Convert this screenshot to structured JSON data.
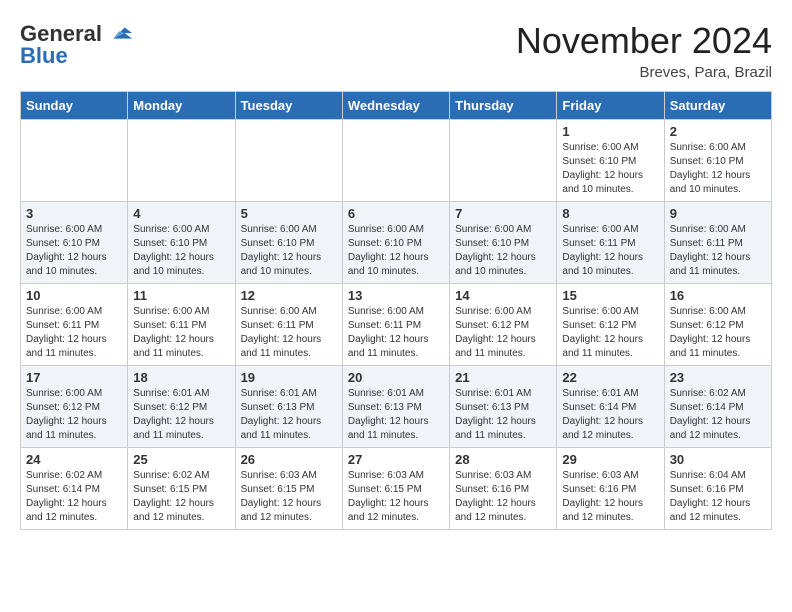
{
  "header": {
    "logo_general": "General",
    "logo_blue": "Blue",
    "month_title": "November 2024",
    "location": "Breves, Para, Brazil"
  },
  "days_of_week": [
    "Sunday",
    "Monday",
    "Tuesday",
    "Wednesday",
    "Thursday",
    "Friday",
    "Saturday"
  ],
  "weeks": [
    [
      {
        "day": "",
        "info": ""
      },
      {
        "day": "",
        "info": ""
      },
      {
        "day": "",
        "info": ""
      },
      {
        "day": "",
        "info": ""
      },
      {
        "day": "",
        "info": ""
      },
      {
        "day": "1",
        "info": "Sunrise: 6:00 AM\nSunset: 6:10 PM\nDaylight: 12 hours\nand 10 minutes."
      },
      {
        "day": "2",
        "info": "Sunrise: 6:00 AM\nSunset: 6:10 PM\nDaylight: 12 hours\nand 10 minutes."
      }
    ],
    [
      {
        "day": "3",
        "info": "Sunrise: 6:00 AM\nSunset: 6:10 PM\nDaylight: 12 hours\nand 10 minutes."
      },
      {
        "day": "4",
        "info": "Sunrise: 6:00 AM\nSunset: 6:10 PM\nDaylight: 12 hours\nand 10 minutes."
      },
      {
        "day": "5",
        "info": "Sunrise: 6:00 AM\nSunset: 6:10 PM\nDaylight: 12 hours\nand 10 minutes."
      },
      {
        "day": "6",
        "info": "Sunrise: 6:00 AM\nSunset: 6:10 PM\nDaylight: 12 hours\nand 10 minutes."
      },
      {
        "day": "7",
        "info": "Sunrise: 6:00 AM\nSunset: 6:10 PM\nDaylight: 12 hours\nand 10 minutes."
      },
      {
        "day": "8",
        "info": "Sunrise: 6:00 AM\nSunset: 6:11 PM\nDaylight: 12 hours\nand 10 minutes."
      },
      {
        "day": "9",
        "info": "Sunrise: 6:00 AM\nSunset: 6:11 PM\nDaylight: 12 hours\nand 11 minutes."
      }
    ],
    [
      {
        "day": "10",
        "info": "Sunrise: 6:00 AM\nSunset: 6:11 PM\nDaylight: 12 hours\nand 11 minutes."
      },
      {
        "day": "11",
        "info": "Sunrise: 6:00 AM\nSunset: 6:11 PM\nDaylight: 12 hours\nand 11 minutes."
      },
      {
        "day": "12",
        "info": "Sunrise: 6:00 AM\nSunset: 6:11 PM\nDaylight: 12 hours\nand 11 minutes."
      },
      {
        "day": "13",
        "info": "Sunrise: 6:00 AM\nSunset: 6:11 PM\nDaylight: 12 hours\nand 11 minutes."
      },
      {
        "day": "14",
        "info": "Sunrise: 6:00 AM\nSunset: 6:12 PM\nDaylight: 12 hours\nand 11 minutes."
      },
      {
        "day": "15",
        "info": "Sunrise: 6:00 AM\nSunset: 6:12 PM\nDaylight: 12 hours\nand 11 minutes."
      },
      {
        "day": "16",
        "info": "Sunrise: 6:00 AM\nSunset: 6:12 PM\nDaylight: 12 hours\nand 11 minutes."
      }
    ],
    [
      {
        "day": "17",
        "info": "Sunrise: 6:00 AM\nSunset: 6:12 PM\nDaylight: 12 hours\nand 11 minutes."
      },
      {
        "day": "18",
        "info": "Sunrise: 6:01 AM\nSunset: 6:12 PM\nDaylight: 12 hours\nand 11 minutes."
      },
      {
        "day": "19",
        "info": "Sunrise: 6:01 AM\nSunset: 6:13 PM\nDaylight: 12 hours\nand 11 minutes."
      },
      {
        "day": "20",
        "info": "Sunrise: 6:01 AM\nSunset: 6:13 PM\nDaylight: 12 hours\nand 11 minutes."
      },
      {
        "day": "21",
        "info": "Sunrise: 6:01 AM\nSunset: 6:13 PM\nDaylight: 12 hours\nand 11 minutes."
      },
      {
        "day": "22",
        "info": "Sunrise: 6:01 AM\nSunset: 6:14 PM\nDaylight: 12 hours\nand 12 minutes."
      },
      {
        "day": "23",
        "info": "Sunrise: 6:02 AM\nSunset: 6:14 PM\nDaylight: 12 hours\nand 12 minutes."
      }
    ],
    [
      {
        "day": "24",
        "info": "Sunrise: 6:02 AM\nSunset: 6:14 PM\nDaylight: 12 hours\nand 12 minutes."
      },
      {
        "day": "25",
        "info": "Sunrise: 6:02 AM\nSunset: 6:15 PM\nDaylight: 12 hours\nand 12 minutes."
      },
      {
        "day": "26",
        "info": "Sunrise: 6:03 AM\nSunset: 6:15 PM\nDaylight: 12 hours\nand 12 minutes."
      },
      {
        "day": "27",
        "info": "Sunrise: 6:03 AM\nSunset: 6:15 PM\nDaylight: 12 hours\nand 12 minutes."
      },
      {
        "day": "28",
        "info": "Sunrise: 6:03 AM\nSunset: 6:16 PM\nDaylight: 12 hours\nand 12 minutes."
      },
      {
        "day": "29",
        "info": "Sunrise: 6:03 AM\nSunset: 6:16 PM\nDaylight: 12 hours\nand 12 minutes."
      },
      {
        "day": "30",
        "info": "Sunrise: 6:04 AM\nSunset: 6:16 PM\nDaylight: 12 hours\nand 12 minutes."
      }
    ]
  ]
}
